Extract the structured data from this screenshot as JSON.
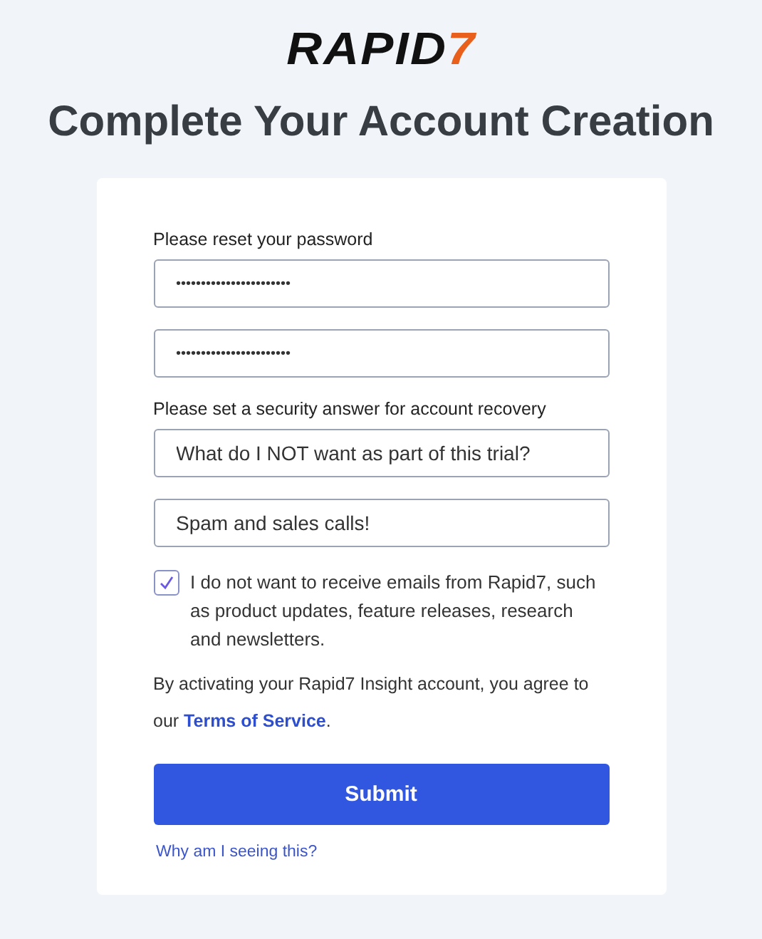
{
  "logo": {
    "text": "RAPID",
    "mark": "7"
  },
  "title": "Complete Your Account Creation",
  "form": {
    "password_label": "Please reset your password",
    "password_fields": [
      {
        "value": "•••••••••••••••••••••••"
      },
      {
        "value": "•••••••••••••••••••••••"
      }
    ],
    "security_label": "Please set a security answer for account recovery",
    "security_fields": [
      {
        "value": "What do I NOT want as part of this trial?"
      },
      {
        "value": "Spam and sales calls!"
      }
    ],
    "opt_out": {
      "checked": true,
      "label": "I do not want to receive emails from Rapid7, such as product updates, feature releases, research and newsletters."
    },
    "agreement": {
      "text": "By activating your Rapid7 Insight account, you agree to our ",
      "link": "Terms of Service",
      "end": "."
    },
    "submit": "Submit",
    "help_link": "Why am I seeing this?"
  }
}
